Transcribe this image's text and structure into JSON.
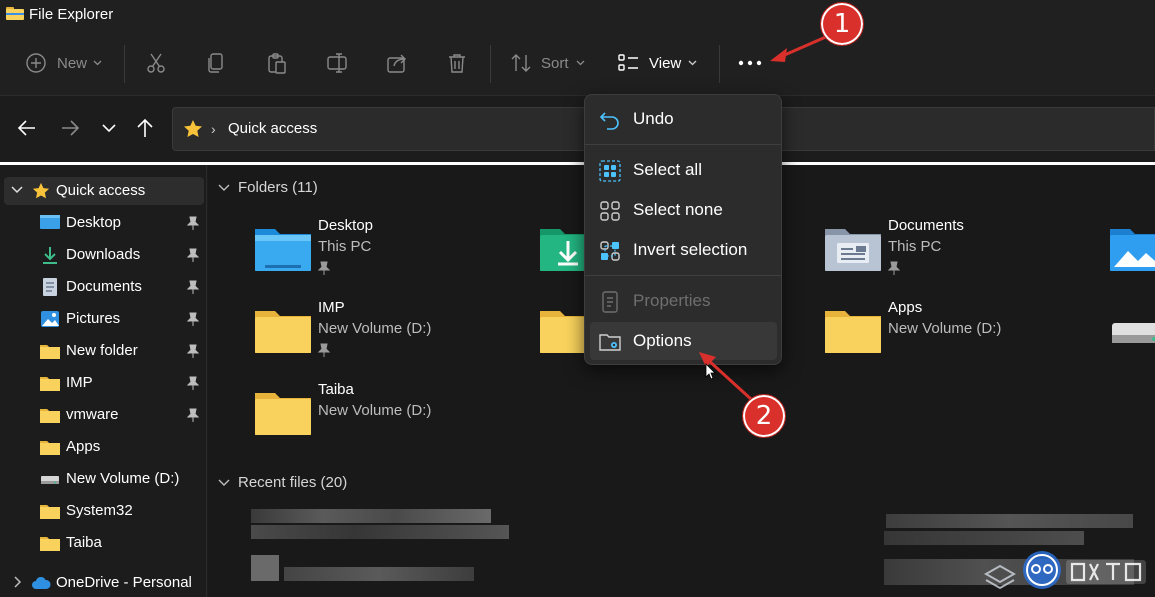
{
  "window": {
    "title": "File Explorer"
  },
  "toolbar": {
    "new_label": "New",
    "sort_label": "Sort",
    "view_label": "View",
    "more_label": "..."
  },
  "address": {
    "path": "Quick access"
  },
  "sidebar": {
    "items": [
      {
        "label": "Quick access",
        "icon": "star-icon"
      },
      {
        "label": "Desktop",
        "icon": "desktop-icon"
      },
      {
        "label": "Downloads",
        "icon": "download-icon"
      },
      {
        "label": "Documents",
        "icon": "documents-icon"
      },
      {
        "label": "Pictures",
        "icon": "pictures-icon"
      },
      {
        "label": "New folder",
        "icon": "folder-icon"
      },
      {
        "label": "IMP",
        "icon": "folder-icon"
      },
      {
        "label": "vmware",
        "icon": "folder-icon"
      },
      {
        "label": "Apps",
        "icon": "folder-icon"
      },
      {
        "label": "New Volume (D:)",
        "icon": "drive-icon"
      },
      {
        "label": "System32",
        "icon": "folder-icon"
      },
      {
        "label": "Taiba",
        "icon": "folder-icon"
      },
      {
        "label": "OneDrive - Personal",
        "icon": "cloud-icon"
      }
    ]
  },
  "main": {
    "folders_header": "Folders (11)",
    "recent_header": "Recent files (20)",
    "folders": [
      {
        "name": "Desktop",
        "sub": "This PC",
        "pinned": true
      },
      {
        "name": "Documents",
        "sub": "This PC",
        "pinned": true
      },
      {
        "name": "IMP",
        "sub": "New Volume (D:)",
        "pinned": true
      },
      {
        "name": "Apps",
        "sub": "New Volume (D:)",
        "pinned": false
      },
      {
        "name": "Taiba",
        "sub": "New Volume (D:)",
        "pinned": false
      }
    ]
  },
  "menu": {
    "undo": "Undo",
    "select_all": "Select all",
    "select_none": "Select none",
    "invert_selection": "Invert selection",
    "properties": "Properties",
    "options": "Options"
  },
  "annotations": {
    "step1": "1",
    "step2": "2"
  },
  "colors": {
    "accent": "#4cc2ff",
    "folder": "#f8d25c",
    "badge": "#d9302c"
  }
}
